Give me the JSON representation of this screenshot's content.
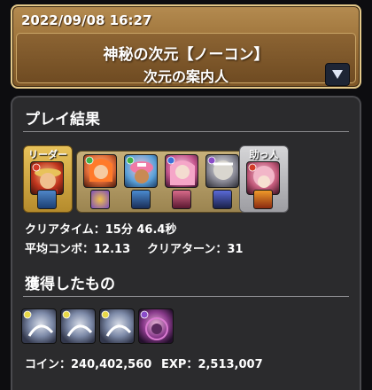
{
  "header": {
    "datetime": "2022/09/08 16:27",
    "title": "神秘の次元【ノーコン】",
    "subtitle": "次元の案内人"
  },
  "result": {
    "section_title": "プレイ結果",
    "leader_label": "リーダー",
    "helper_label": "助っ人",
    "clear_time_label": "クリアタイム：",
    "clear_time_value": "15分 46.4秒",
    "avg_combo_label": "平均コンボ：",
    "avg_combo_value": "12.13",
    "clear_turn_label": "クリアターン：",
    "clear_turn_value": "31"
  },
  "obtained": {
    "section_title": "獲得したもの",
    "coin_label": "コイン：",
    "coin_value": "240,402,560",
    "exp_label": "EXP：",
    "exp_value": "2,513,007"
  },
  "colors": {
    "header_gold": "#9a7038",
    "panel_bg": "#2b2b2d",
    "leader_frame": "#e8c25a",
    "helper_frame": "#d6d6d8"
  }
}
